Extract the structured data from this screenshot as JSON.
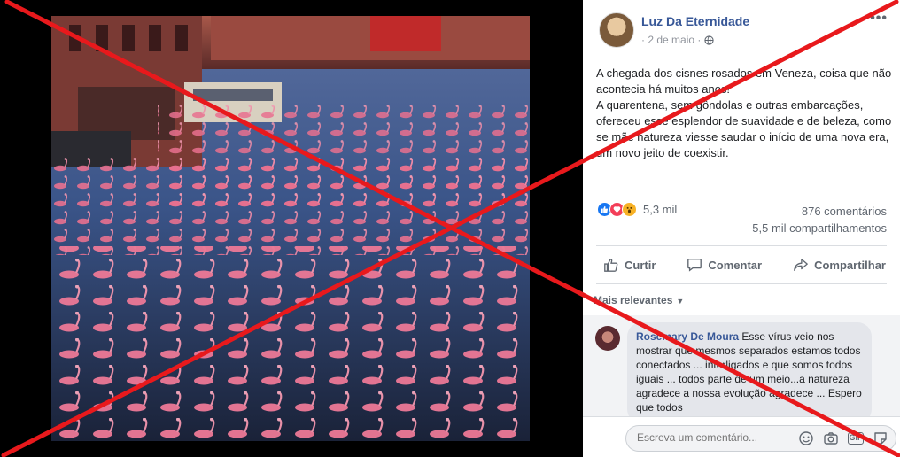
{
  "post": {
    "author": "Luz Da Eternidade",
    "date": "· 2 de maio ·",
    "more_label": "•••",
    "text_lines": [
      "A chegada dos cisnes rosados em Veneza, coisa que não acontecia há muitos anos!",
      "A quarentena, sem gôndolas e outras embarcações, ofereceu esse esplendor de suavidade e de beleza, como se mãe natureza viesse saudar o início de uma nova era, um novo jeito de coexistir."
    ],
    "reactions_count": "5,3 mil",
    "comments_count": "876 comentários",
    "shares_count": "5,5 mil compartilhamentos"
  },
  "actions": {
    "like": "Curtir",
    "comment": "Comentar",
    "share": "Compartilhar"
  },
  "sort_label": "Mais relevantes",
  "comment": {
    "author": "Rosemary De Moura",
    "text": "Esse vírus veio nos mostrar que mesmos separados estamos todos conectados ... interligados e que somos todos iguais ... todos parte de um meio...a natureza agradece a nossa evolução agradece ... Espero que todos"
  },
  "composer": {
    "placeholder": "Escreva um comentário...",
    "gif_label": "GIF"
  },
  "colors": {
    "overlay_x": "#e8191c",
    "link_blue": "#385898",
    "flamingo_pink": "#e8708f"
  },
  "icons": [
    "globe-icon",
    "like-icon",
    "comment-icon",
    "share-icon",
    "emoji-icon",
    "camera-icon",
    "gif-icon",
    "sticker-icon"
  ]
}
